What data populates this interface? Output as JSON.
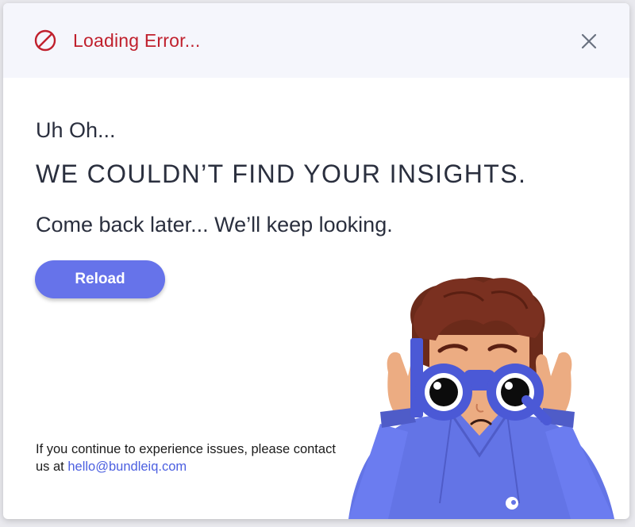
{
  "header": {
    "title": "Loading Error...",
    "icon": "prohibited-icon",
    "close_icon": "close-icon",
    "error_color": "#c0202d"
  },
  "content": {
    "greeting": "Uh Oh...",
    "headline": "WE COULDN’T FIND YOUR INSIGHTS.",
    "subtext": "Come back later...  We’ll keep looking.",
    "reload_label": "Reload"
  },
  "footer": {
    "contact_text": "If you continue to experience issues, please contact us at",
    "email": "hello@bundleiq.com"
  },
  "colors": {
    "accent": "#6673ea",
    "header_bg": "#f5f6fc",
    "text": "#2a2f3e",
    "link": "#4b5fe0"
  },
  "illustration": {
    "icon": "person-with-binoculars-illustration"
  }
}
